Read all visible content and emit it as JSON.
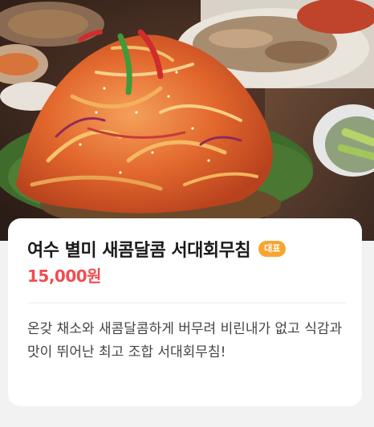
{
  "menu_item": {
    "image_alt": "spicy seasoned vegetable salad dish photo",
    "title": "여수 별미 새콤달콤 서대회무침",
    "badge": "대표",
    "price": "15,000원",
    "description": "온갖 채소와 새콤달콤하게 버무려 비린내가 없고 식감과 맛이 뛰어난 최고 조합 서대회무침!"
  },
  "colors": {
    "badge": "#f7a531",
    "price": "#ef4d52",
    "card_bg": "#ffffff",
    "page_bg": "#f2f2f2"
  }
}
